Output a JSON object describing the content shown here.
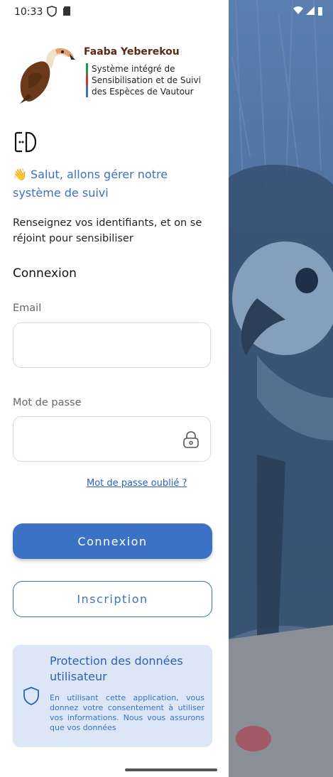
{
  "status_bar": {
    "time": "10:33"
  },
  "brand": {
    "title": "Faaba Yeberekou",
    "subtitle_lines": [
      "Système intégré de",
      "Sensibilisation et de Suivi",
      "des Espèces de Vautour"
    ],
    "bar_colors": [
      "#1f9a4a",
      "#d63030",
      "#3b72c4"
    ]
  },
  "greeting": "👋 Salut, allons gérer notre système de suivi",
  "intro": "Renseignez vos identifiants, et on se réjoint pour sensibiliser",
  "login": {
    "heading": "Connexion",
    "email_label": "Email",
    "email_value": "",
    "password_label": "Mot de passe",
    "password_value": "",
    "forgot_link": "Mot de passe oublié ?",
    "login_button": "Connexion",
    "register_button": "Inscription"
  },
  "privacy": {
    "title": "Protection des données utilisateur",
    "text": "En utilisant cette application, vous donnez votre consentement à utiliser vos informations. Nous vous assurons que vos données"
  },
  "colors": {
    "accent": "#3b72c4",
    "brand_brown": "#5a2a14",
    "card_bg": "#dce6f6"
  }
}
